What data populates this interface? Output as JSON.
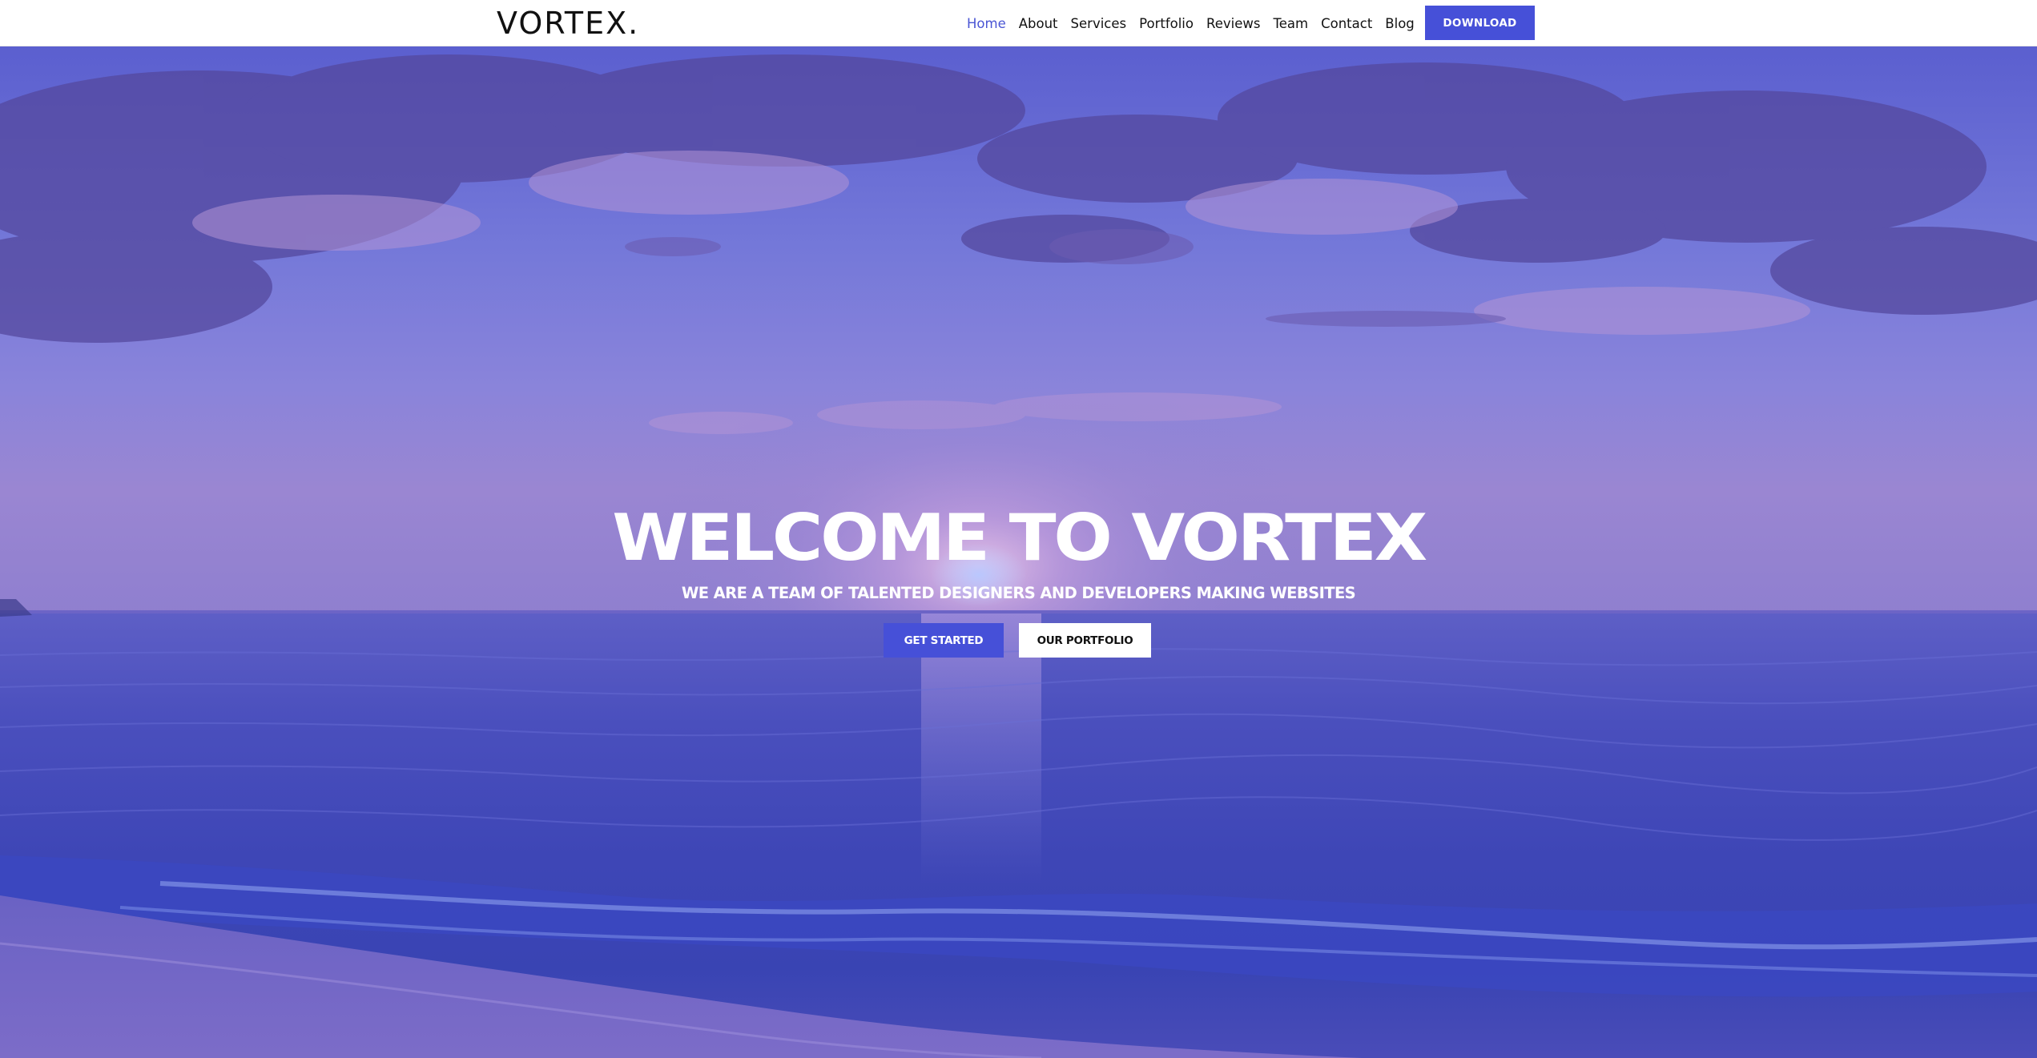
{
  "header": {
    "logo": "VORTEX.",
    "nav": [
      {
        "label": "Home",
        "active": true
      },
      {
        "label": "About",
        "active": false
      },
      {
        "label": "Services",
        "active": false
      },
      {
        "label": "Portfolio",
        "active": false
      },
      {
        "label": "Reviews",
        "active": false
      },
      {
        "label": "Team",
        "active": false
      },
      {
        "label": "Contact",
        "active": false
      },
      {
        "label": "Blog",
        "active": false
      }
    ],
    "download_label": "DOWNLOAD"
  },
  "hero": {
    "title": "WELCOME TO VORTEX",
    "subtitle": "WE ARE A TEAM OF TALENTED DESIGNERS AND DEVELOPERS MAKING WEBSITES",
    "primary_label": "GET STARTED",
    "secondary_label": "OUR PORTFOLIO"
  },
  "colors": {
    "accent": "#4650d8",
    "active_link": "#4a55d4",
    "sky": "#6b70d6",
    "sea": "#4047b8"
  }
}
